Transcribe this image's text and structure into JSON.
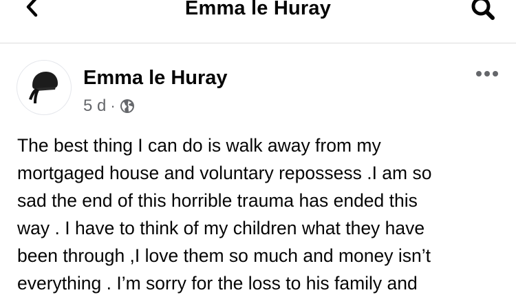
{
  "header": {
    "title": "Emma le Huray",
    "back_icon": "chevron-left-icon",
    "search_icon": "search-icon"
  },
  "post": {
    "author": "Emma le Huray",
    "time": "5 d",
    "separator": "·",
    "audience_icon": "globe-icon",
    "more_icon": "more-horizontal-icon",
    "text": "The best thing I can do is walk away from my\nmortgaged house and voluntary repossess .I am so\nsad the end of this horrible trauma has ended this\nway . I have to think of my children what they have\nbeen through ,I love them so much and money isn’t\neverything . I’m sorry for the loss to his family and"
  },
  "colors": {
    "text_primary": "#050505",
    "text_secondary": "#65676b",
    "divider": "#dcdcdc"
  }
}
